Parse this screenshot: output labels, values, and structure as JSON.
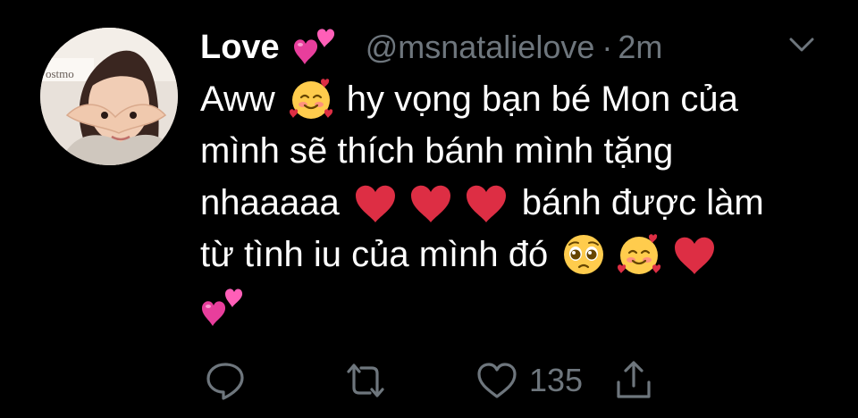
{
  "tweet": {
    "display_name": "Love",
    "handle": "@msnatalielove",
    "separator": "·",
    "time": "2m",
    "lines": {
      "l1_a": "Aww",
      "l1_b": "hy vọng bạn bé Mon của",
      "l2": "mình sẽ thích bánh mình tặng",
      "l3_a": "nhaaaaa",
      "l3_b": "bánh được làm",
      "l4_a": "từ tình iu của mình đó"
    },
    "emoji": {
      "name": "two-hearts",
      "line1": "smiling-face-with-hearts",
      "line3": [
        "red-heart",
        "red-heart",
        "red-heart"
      ],
      "line4": [
        "pleading-face",
        "smiling-face-with-hearts",
        "red-heart"
      ],
      "line5": "two-hearts"
    }
  },
  "actions": {
    "like_count": "135"
  },
  "colors": {
    "background": "#000000",
    "text": "#ffffff",
    "muted": "#6e767d",
    "heart_red": "#dd2e44",
    "pink_heart": "#e83e9c"
  }
}
